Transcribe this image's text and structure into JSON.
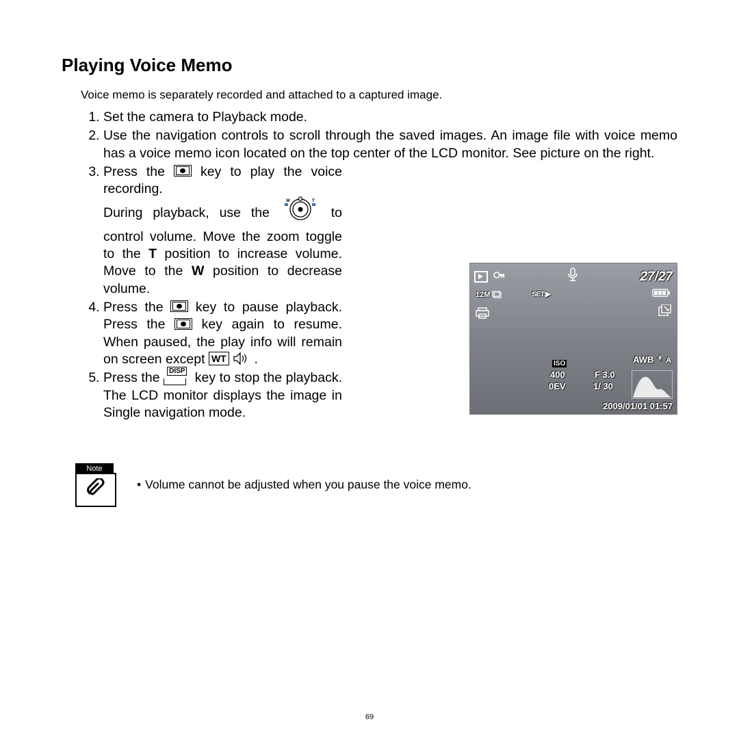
{
  "title": "Playing Voice Memo",
  "intro": "Voice memo is separately recorded and attached to a captured image.",
  "steps": {
    "s1": "Set the camera to Playback mode.",
    "s2": "Use the navigation controls to scroll through the saved images. An image file with voice memo has a voice memo icon located on the top center of the LCD monitor. See picture on the right.",
    "s3a": "Press the ",
    "s3b": " key to play the voice recording.",
    "s3c": "During playback, use the ",
    "s3d": " to control volume. Move the zoom toggle to the ",
    "s3e": " position to increase volume. Move to the ",
    "s3f": " position to decrease volume.",
    "t_label": "T",
    "w_label": "W",
    "s4a": "Press the ",
    "s4b": " key to pause playback. Press the ",
    "s4c": " key again to resume. When paused, the play info will remain on screen except ",
    "s4d": ".",
    "wt_label": "WT",
    "s5a": "Press the ",
    "s5b": " key to stop the playback. The LCD monitor displays the image in Single navigation mode.",
    "disp_label": "DISP"
  },
  "lcd": {
    "counter": "27/27",
    "size": "12M",
    "setplay": "SET:▶",
    "iso_label": "ISO",
    "iso": "400",
    "ev": "0EV",
    "fstop": "F 3.0",
    "shutter": "1/ 30",
    "awb": "AWB",
    "flash": "A",
    "datetime": "2009/01/01  01:57"
  },
  "note": {
    "badge": "Note",
    "text": "Volume cannot be adjusted when you pause the voice memo."
  },
  "page_number": "69"
}
